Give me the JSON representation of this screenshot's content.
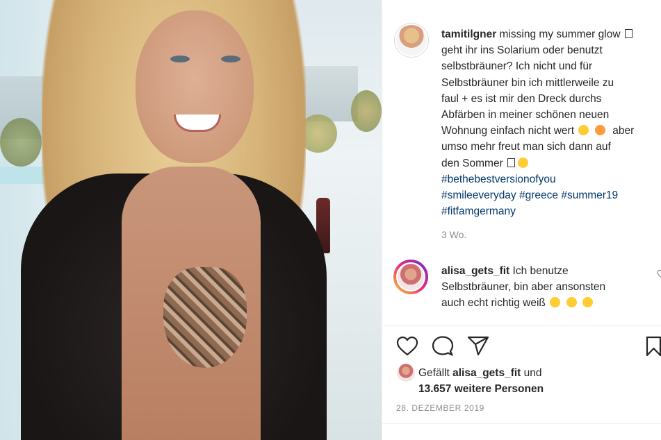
{
  "post": {
    "author": "tamitilgner",
    "caption_lines": [
      "missing my summer glow",
      "geht ihr ins Solarium oder benutzt",
      "selbstbräuner? Ich nicht und für",
      "Selbstbräuner bin ich mittlerweile zu",
      "faul + es ist mir den Dreck durchs",
      "Abfärben in meiner schönen neuen",
      "Wohnung einfach nicht wert",
      "aber",
      "umso mehr freut man sich dann auf",
      "den Sommer"
    ],
    "hashtags": [
      "#bethebestversionofyou",
      "#smileeveryday",
      "#greece",
      "#summer19",
      "#fitfamgermany"
    ],
    "time_ago": "3 Wo."
  },
  "comment": {
    "author": "alisa_gets_fit",
    "lines": [
      "Ich benutze",
      "Selbstbräuner, bin aber ansonsten",
      "auch echt richtig weiß"
    ]
  },
  "actions": {
    "like_icon": "heart-icon",
    "comment_icon": "speech-bubble-icon",
    "share_icon": "paper-plane-icon",
    "save_icon": "bookmark-icon"
  },
  "likes": {
    "prefix": "Gefällt",
    "user": "alisa_gets_fit",
    "conjunction": "und",
    "count_text": "13.657 weitere Personen"
  },
  "date": "28. DEZEMBER 2019"
}
